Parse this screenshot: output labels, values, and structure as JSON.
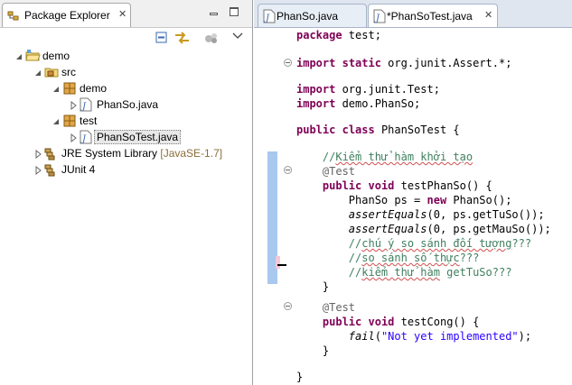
{
  "package_explorer": {
    "tab_label": "Package Explorer",
    "tree": {
      "project": "demo",
      "src": "src",
      "package_demo": "demo",
      "file_phanso": "PhanSo.java",
      "package_test": "test",
      "file_phansotest": "PhanSoTest.java",
      "jre": "JRE System Library",
      "jre_version": "[JavaSE-1.7]",
      "junit": "JUnit 4"
    }
  },
  "editor": {
    "tabs": [
      {
        "label": "PhanSo.java"
      },
      {
        "label": "*PhanSoTest.java"
      }
    ],
    "code": {
      "l01_kw": "package",
      "l01_rest": " test;",
      "l02_kw1": "import",
      "l02_kw2": "static",
      "l02_rest": " org.junit.Assert.*;",
      "l03_kw": "import",
      "l03_rest": " org.junit.Test;",
      "l04_kw": "import",
      "l04_rest": " demo.PhanSo;",
      "l05_kw1": "public",
      "l05_kw2": "class",
      "l05_rest": " PhanSoTest {",
      "l06_comment_a": "//",
      "l06_comment_b": "Kiểm thử hàm khởi tạo",
      "l07_annotation": "@Test",
      "l08_kw1": "public",
      "l08_kw2": "void",
      "l08_rest": " testPhanSo() {",
      "l09_a": "PhanSo ps = ",
      "l09_kw": "new",
      "l09_b": " PhanSo();",
      "l10_it": "assertEquals",
      "l10_rest": "(0, ps.getTuSo());",
      "l11_it": "assertEquals",
      "l11_rest": "(0, ps.getMauSo());",
      "l12_a": "//",
      "l12_b": "chú ý so sánh đối tượng",
      "l12_c": "???",
      "l13_a": "//",
      "l13_b": "so sánh số thực",
      "l13_c": "???",
      "l14_a": "//",
      "l14_b": "kiểm thử hàm",
      "l14_c": " getTuSo???",
      "l15": "}",
      "l16_annotation": "@Test",
      "l17_kw1": "public",
      "l17_kw2": "void",
      "l17_rest": " testCong() {",
      "l18_it": "fail",
      "l18_a": "(",
      "l18_str": "\"Not yet implemented\"",
      "l18_b": ");",
      "l19": "}",
      "l20": "}"
    }
  }
}
